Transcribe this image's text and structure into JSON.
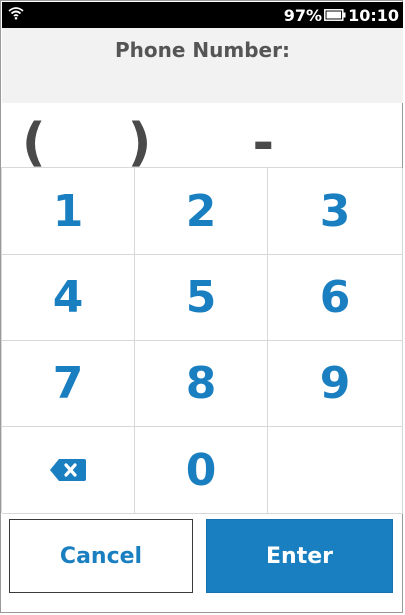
{
  "status_bar": {
    "battery_percent": "97%",
    "time": "10:10",
    "icons": [
      "wifi-icon",
      "battery-icon"
    ]
  },
  "header": {
    "title": "Phone Number:"
  },
  "phone_display": {
    "value": "(___) ___-____"
  },
  "keypad": {
    "keys": [
      "1",
      "2",
      "3",
      "4",
      "5",
      "6",
      "7",
      "8",
      "9",
      "0"
    ],
    "backspace_icon": "backspace-icon"
  },
  "actions": {
    "cancel_label": "Cancel",
    "enter_label": "Enter"
  },
  "colors": {
    "accent": "#1a7fc0",
    "header_background": "#f2f2f2",
    "status_bar_background": "#000000",
    "display_text": "#4a4a4a"
  }
}
